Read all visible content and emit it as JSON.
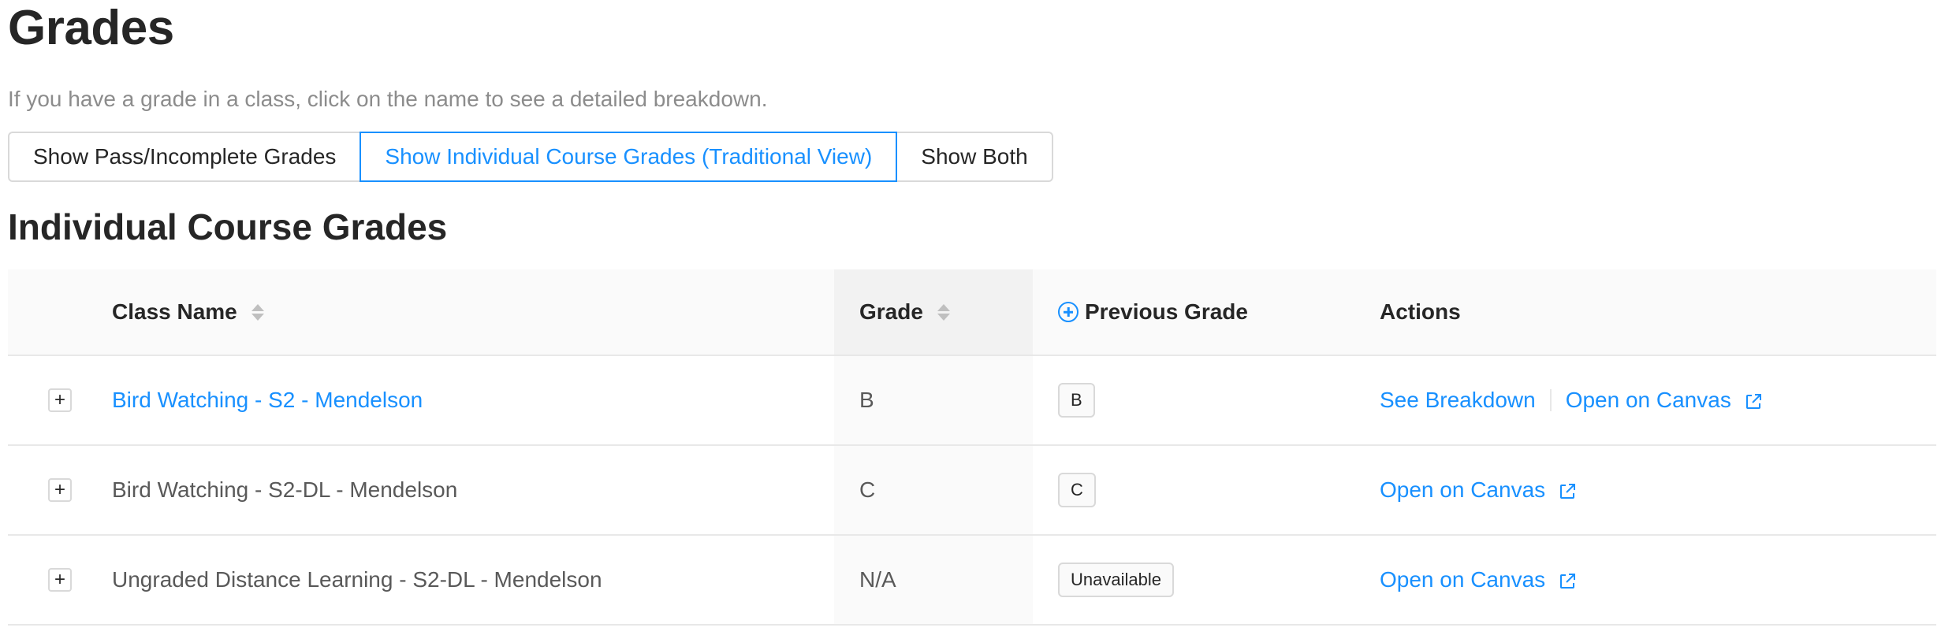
{
  "page": {
    "title": "Grades",
    "subtitle": "If you have a grade in a class, click on the name to see a detailed breakdown."
  },
  "view_toggle": {
    "options": [
      {
        "label": "Show Pass/Incomplete Grades",
        "active": false
      },
      {
        "label": "Show Individual Course Grades (Traditional View)",
        "active": true
      },
      {
        "label": "Show Both",
        "active": false
      }
    ]
  },
  "section": {
    "title": "Individual Course Grades"
  },
  "table": {
    "columns": {
      "class_name": "Class Name",
      "grade": "Grade",
      "previous_grade": "Previous Grade",
      "actions": "Actions"
    },
    "rows": [
      {
        "expand": "+",
        "class_name": "Bird Watching - S2 - Mendelson",
        "name_is_link": true,
        "grade": "B",
        "previous_grade": "B",
        "action_breakdown": "See Breakdown",
        "action_canvas": "Open on Canvas"
      },
      {
        "expand": "+",
        "class_name": "Bird Watching - S2-DL - Mendelson",
        "name_is_link": false,
        "grade": "C",
        "previous_grade": "C",
        "action_canvas": "Open on Canvas"
      },
      {
        "expand": "+",
        "class_name": "Ungraded Distance Learning - S2-DL - Mendelson",
        "name_is_link": false,
        "grade": "N/A",
        "previous_grade": "Unavailable",
        "action_canvas": "Open on Canvas"
      }
    ]
  },
  "colors": {
    "accent": "#1890ff",
    "text": "#262626",
    "muted": "#8c8c8c",
    "border": "#d9d9d9",
    "header_bg": "#fafafa"
  },
  "icons": {
    "sort": "sort-icon",
    "expand": "plus-icon",
    "previous_grade_header": "plus-circle-icon",
    "external_link": "external-link-icon"
  }
}
